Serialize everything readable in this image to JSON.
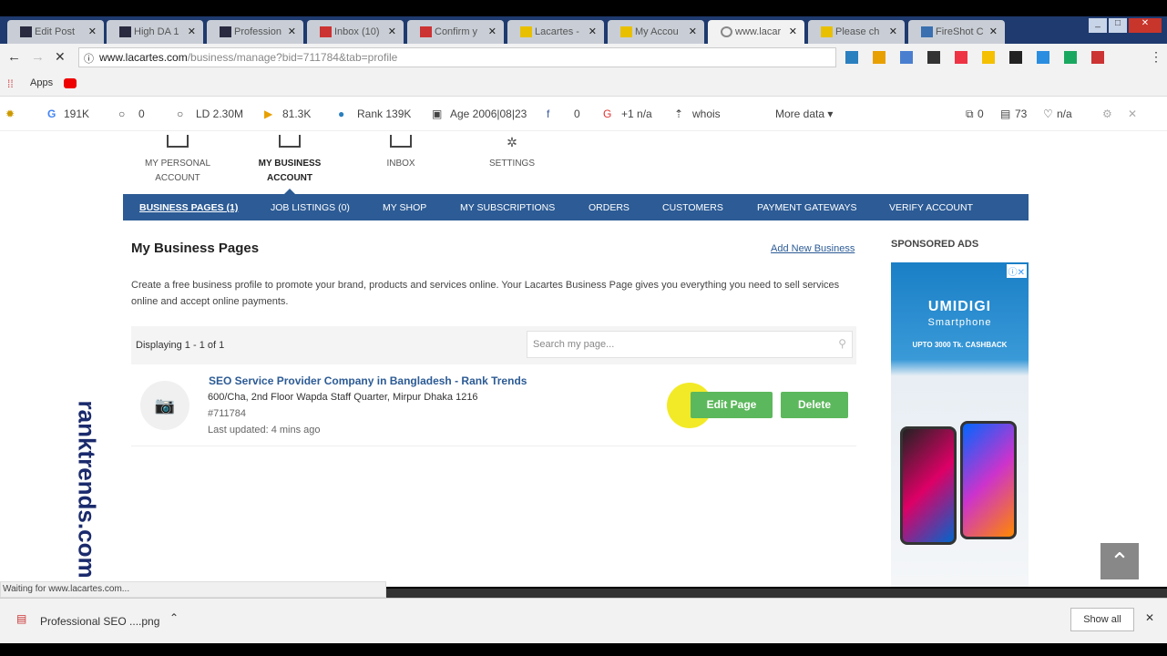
{
  "tabs": [
    "Edit Post",
    "High DA 1",
    "Profession",
    "Inbox (10)",
    "Confirm y",
    "Lacartes -",
    "My Accou",
    "www.lacar",
    "Please ch",
    "FireShot C"
  ],
  "active_tab": 7,
  "url": {
    "host": "www.lacartes.com",
    "path": "/business/manage?bid=711784&tab=profile"
  },
  "bookmarks": {
    "apps": "Apps"
  },
  "seobar": {
    "g": "191K",
    "l": "0",
    "ld": "LD 2.30M",
    "b": "81.3K",
    "rank": "Rank 139K",
    "age": "Age 2006|08|23",
    "fb": "0",
    "gplus": "+1 n/a",
    "whois": "whois",
    "more": "More data ▾",
    "links": "0",
    "count": "73",
    "heart": "n/a"
  },
  "account_nav": [
    {
      "label": "MY PERSONAL ACCOUNT"
    },
    {
      "label": "MY BUSINESS ACCOUNT"
    },
    {
      "label": "INBOX"
    },
    {
      "label": "SETTINGS"
    }
  ],
  "subnav": [
    "BUSINESS PAGES (1)",
    "JOB LISTINGS (0)",
    "MY SHOP",
    "MY SUBSCRIPTIONS",
    "ORDERS",
    "CUSTOMERS",
    "PAYMENT GATEWAYS",
    "VERIFY ACCOUNT"
  ],
  "main": {
    "title": "My Business Pages",
    "add_link": "Add New Business",
    "description": "Create a free business profile to promote your brand, products and services online. Your Lacartes Business Page gives you everything you need to sell services online and accept online payments.",
    "displaying": "Displaying 1 - 1 of 1",
    "search_placeholder": "Search my page...",
    "listing": {
      "name": "SEO Service Provider Company in Bangladesh - Rank Trends",
      "address": "600/Cha, 2nd Floor Wapda Staff Quarter, Mirpur Dhaka 1216",
      "id": "#711784",
      "updated": "Last updated: 4 mins ago"
    },
    "edit": "Edit Page",
    "delete": "Delete"
  },
  "sidebar": {
    "title": "SPONSORED ADS",
    "ad_brand": "UMIDIGI",
    "ad_sub": "Smartphone",
    "ad_offer": "UPTO 3000 Tk. CASHBACK"
  },
  "watermark": "ranktrends.com",
  "status": "Waiting for www.lacartes.com...",
  "download": {
    "file": "Professional SEO ....png",
    "show_all": "Show all"
  }
}
